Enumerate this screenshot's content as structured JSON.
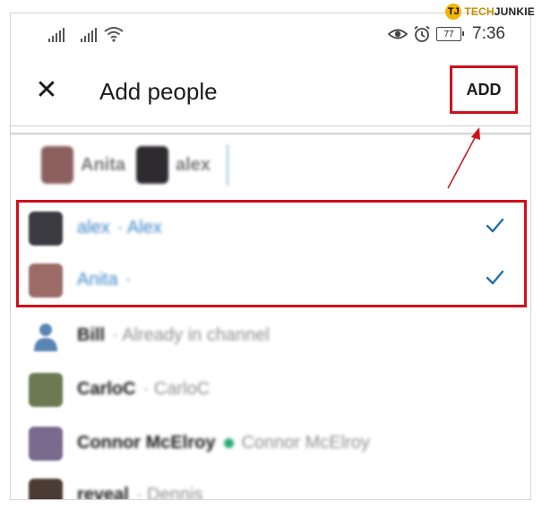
{
  "watermark": {
    "logo": "TJ",
    "brand_a": "TECH",
    "brand_b": "JUNKIE"
  },
  "status_bar": {
    "battery": "77",
    "time": "7:36",
    "icons": [
      "signal-icon",
      "signal-icon",
      "wifi-icon",
      "eye-icon",
      "alarm-icon",
      "battery-icon"
    ]
  },
  "header": {
    "close_icon": "close-icon",
    "title": "Add people",
    "add_label": "ADD"
  },
  "chips": [
    {
      "name": "Anita",
      "avatar_color": "#8c5f5f"
    },
    {
      "name": "alex",
      "avatar_color": "#2d2b30"
    }
  ],
  "rows": [
    {
      "name": "alex",
      "sub": "· Alex",
      "selected": true,
      "avatar_color": "#3a3a40"
    },
    {
      "name": "Anita",
      "sub": "·",
      "selected": true,
      "avatar_color": "#9b6b66"
    },
    {
      "name": "Bill",
      "sub": "· Already in channel",
      "selected": false,
      "avatar_color": "#5a86b5"
    },
    {
      "name": "CarloC",
      "sub": "· CarloC",
      "selected": false,
      "avatar_color": "#6b7a52"
    },
    {
      "name": "Connor McElroy",
      "sub": "Connor McElroy",
      "selected": false,
      "avatar_color": "#7a6a8e",
      "online": true
    },
    {
      "name": "reveal",
      "sub": "· Dennis",
      "selected": false,
      "avatar_color": "#4a3b33"
    }
  ],
  "colors": {
    "annotation": "#d0101a",
    "check": "#1f6fb0",
    "selected_text": "#3d86c6"
  }
}
